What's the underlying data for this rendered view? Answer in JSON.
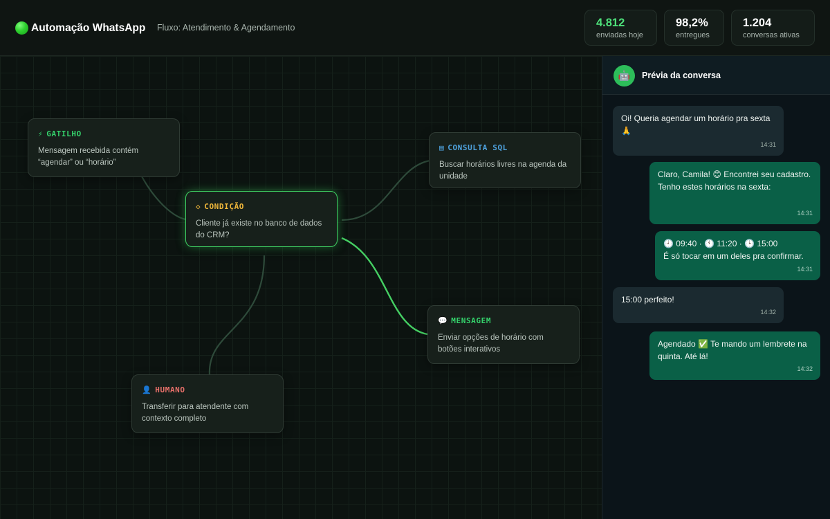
{
  "header": {
    "app_title": "Automação WhatsApp",
    "flow_name": "Fluxo: Atendimento & Agendamento",
    "stats": [
      {
        "value": "4.812",
        "label": "enviadas hoje"
      },
      {
        "value": "98,2%",
        "label": "entregues"
      },
      {
        "value": "1.204",
        "label": "conversas ativas"
      }
    ]
  },
  "nodes": {
    "trigger": {
      "icon": "⚡",
      "title": "GATILHO",
      "desc": "Mensagem recebida contém “agendar” ou “horário”"
    },
    "condition": {
      "icon": "◇",
      "title": "CONDIÇÃO",
      "desc": "Cliente já existe no banco de dados do CRM?"
    },
    "sql": {
      "icon": "▤",
      "title": "CONSULTA SQL",
      "desc": "Buscar horários livres na agenda da unidade"
    },
    "message": {
      "icon": "💬",
      "title": "MENSAGEM",
      "desc": "Enviar opções de horário com botões interativos"
    },
    "human": {
      "icon": "👤",
      "title": "HUMANO",
      "desc": "Transferir para atendente com contexto completo"
    }
  },
  "chat": {
    "avatar_icon": "🤖",
    "title": "Prévia da conversa",
    "messages": [
      {
        "direction": "in",
        "text": "Oi! Queria agendar um horário pra sexta 🙏",
        "time": "14:31"
      },
      {
        "direction": "out",
        "text": "Claro, Camila! 😊 Encontrei seu cadastro. Tenho estes horários na sexta:",
        "time": "14:31"
      },
      {
        "direction": "out",
        "line1": "🕘 09:40  ·  🕚 11:20  ·  🕒 15:00",
        "line2": "É só tocar em um deles pra confirmar.",
        "time": "14:31"
      },
      {
        "direction": "in",
        "text": "15:00 perfeito!",
        "time": "14:32"
      },
      {
        "direction": "out",
        "text": "Agendado ✅ Te mando um lembrete na quinta. Até lá!",
        "time": "14:32"
      }
    ]
  },
  "colors": {
    "accent_green": "#3ecf62",
    "condition_title": "#f0b73a",
    "sql_title": "#4fa3e0",
    "human_title": "#e8706a",
    "outgoing_bubble": "#0a6047",
    "incoming_bubble": "#1b2a30"
  }
}
